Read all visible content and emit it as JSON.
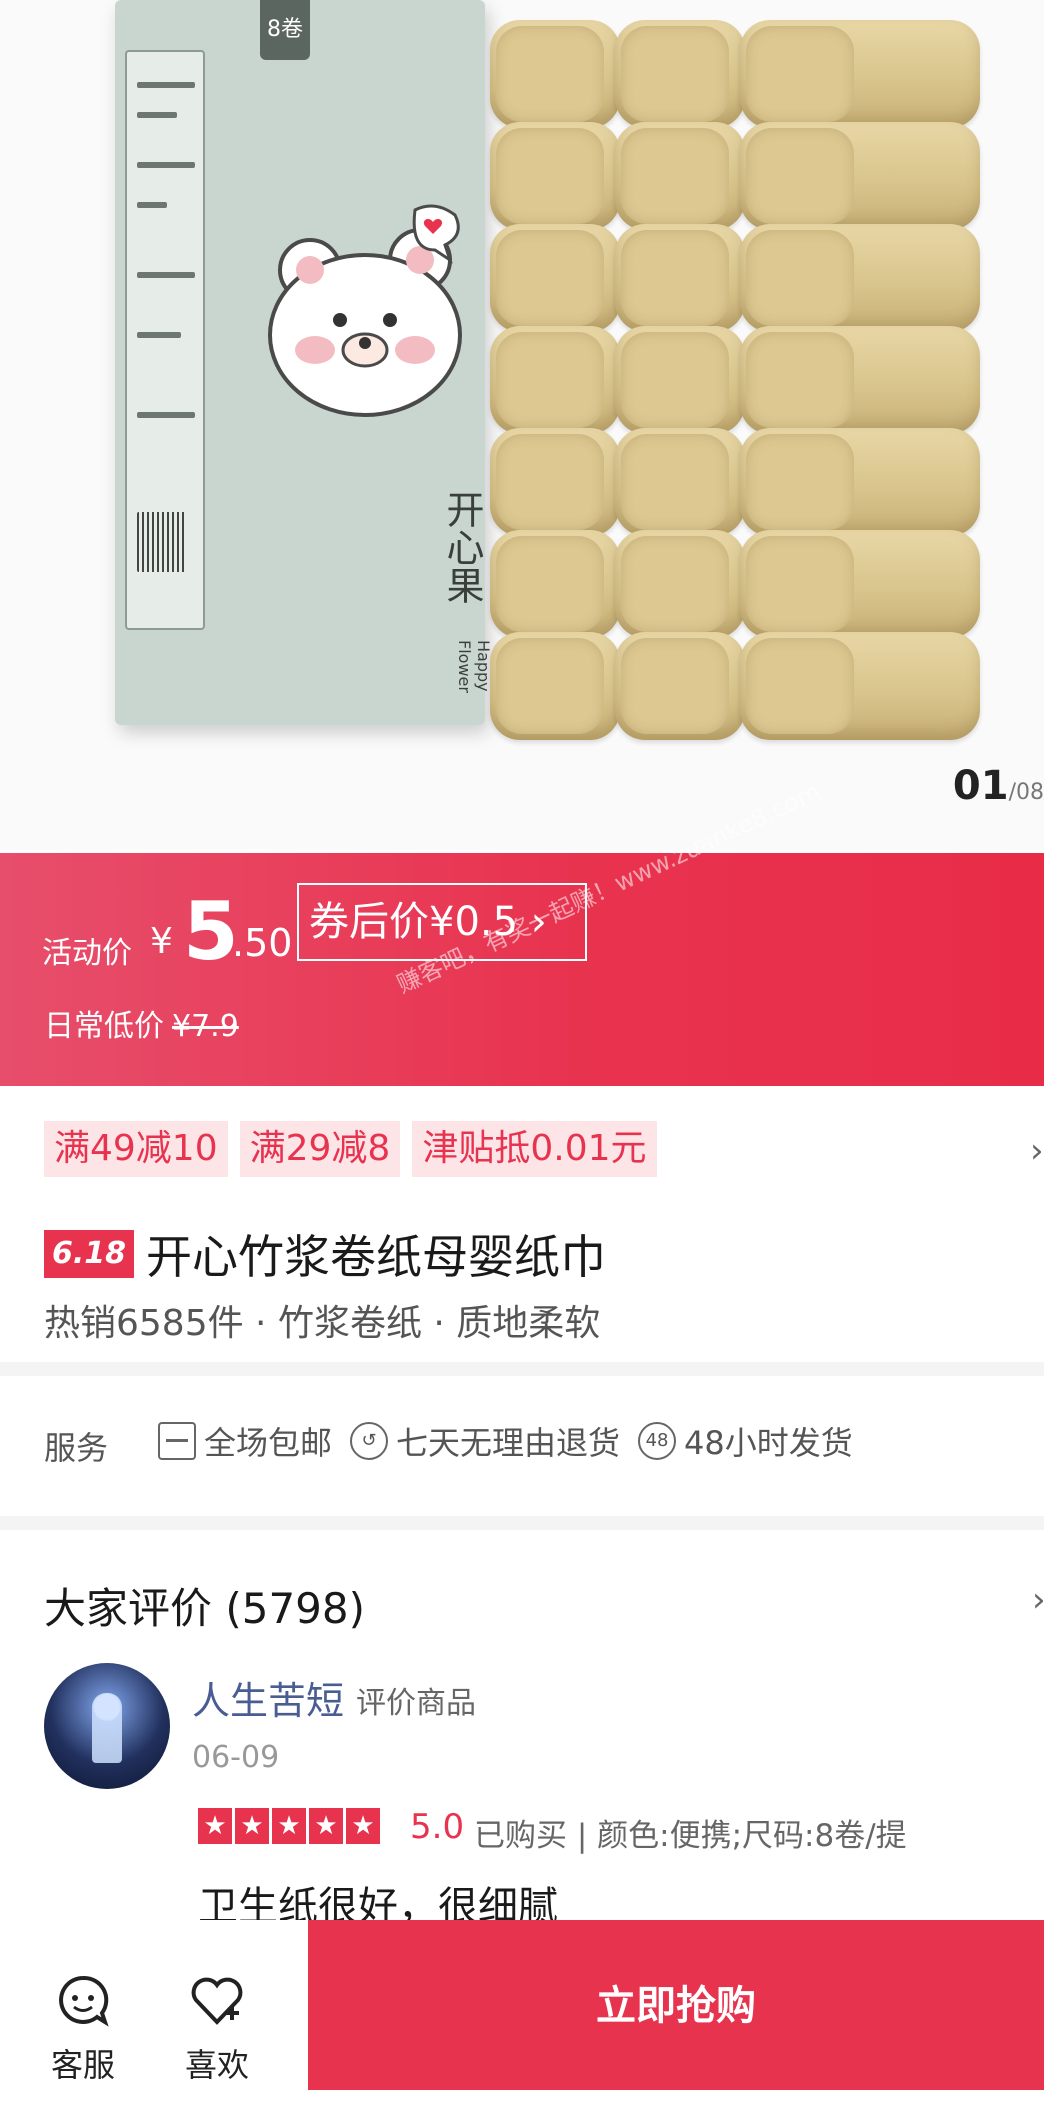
{
  "hero": {
    "box_tag": "8卷",
    "brand_cn": "开心果",
    "brand_en": "Happy Flower",
    "pager_current": "01",
    "pager_total": "/08"
  },
  "price": {
    "activity_label": "活动价",
    "currency": "¥",
    "price_int": "5",
    "price_dec": ".50",
    "coupon_label": "券后价¥0.5 ›",
    "daily_label": "日常低价",
    "daily_price": "¥7.9",
    "watermark": "赚客吧，有奖一起赚！www.zuanke8.com"
  },
  "promo": {
    "tags": [
      "满49减10",
      "满29减8",
      "津贴抵0.01元"
    ],
    "chevron": "›",
    "badge": "6.18",
    "title": "开心竹浆卷纸母婴纸巾",
    "subline": "热销6585件 · 竹浆卷纸 · 质地柔软"
  },
  "service": {
    "label": "服务",
    "items": [
      {
        "icon": "package-icon",
        "glyph": "",
        "label": "全场包邮"
      },
      {
        "icon": "return-icon",
        "glyph": "↺",
        "label": "七天无理由退货"
      },
      {
        "icon": "48h-icon",
        "glyph": "48",
        "label": "48小时发货"
      }
    ]
  },
  "reviews": {
    "title": "大家评价 (5798)",
    "chevron": "›",
    "user": "人生苦短",
    "user_tag": "评价商品",
    "date": "06-09",
    "stars": [
      "★",
      "★",
      "★",
      "★",
      "★"
    ],
    "score": "5.0",
    "meta": "已购买 | 颜色:便携;尺码:8卷/提",
    "text": "卫生纸很好，很细腻"
  },
  "bottom": {
    "service_label": "客服",
    "like_label": "喜欢",
    "buy_label": "立即抢购"
  },
  "colors": {
    "accent": "#e8334f",
    "tag_bg": "#fde4e7",
    "username": "#4a5d92"
  }
}
